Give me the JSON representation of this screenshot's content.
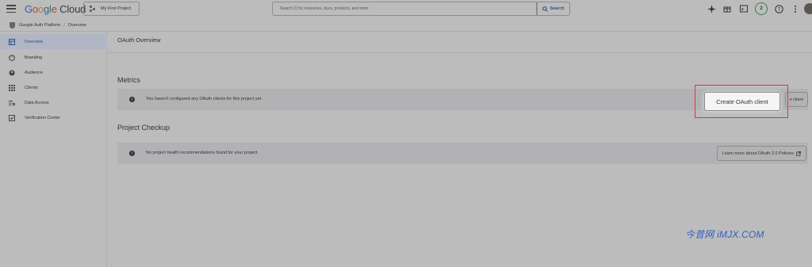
{
  "topbar": {
    "logo_google": "Google",
    "logo_cloud": "Cloud",
    "project": "My First Project",
    "search_placeholder": "Search (/) for resources, docs, products, and more",
    "search_button": "Search",
    "notifications_count": "2"
  },
  "breadcrumb": {
    "root": "Google Auth Platform",
    "separator": "/",
    "current": "Overview"
  },
  "sidebar": {
    "items": [
      {
        "label": "Overview",
        "icon": "dashboard-icon",
        "active": true
      },
      {
        "label": "Branding",
        "icon": "palette-icon"
      },
      {
        "label": "Audience",
        "icon": "account-circle-icon"
      },
      {
        "label": "Clients",
        "icon": "grid-icon"
      },
      {
        "label": "Data Access",
        "icon": "list-settings-icon"
      },
      {
        "label": "Verification Center",
        "icon": "checklist-icon"
      }
    ]
  },
  "main": {
    "title": "OAuth Overview",
    "metrics": {
      "heading": "Metrics",
      "message": "You haven't configured any OAuth clients for this project yet.",
      "button_partial": "e client"
    },
    "create_button": "Create OAuth client",
    "checkup": {
      "heading": "Project Checkup",
      "message": "No project health recommendations found for your project.",
      "button": "Learn more about OAuth 2.0 Policies"
    }
  },
  "watermark": "今昔网 iMJX.COM",
  "colors": {
    "background": "#bdbcbd",
    "accent": "#2e4f8a",
    "highlight": "#d23a3a"
  }
}
